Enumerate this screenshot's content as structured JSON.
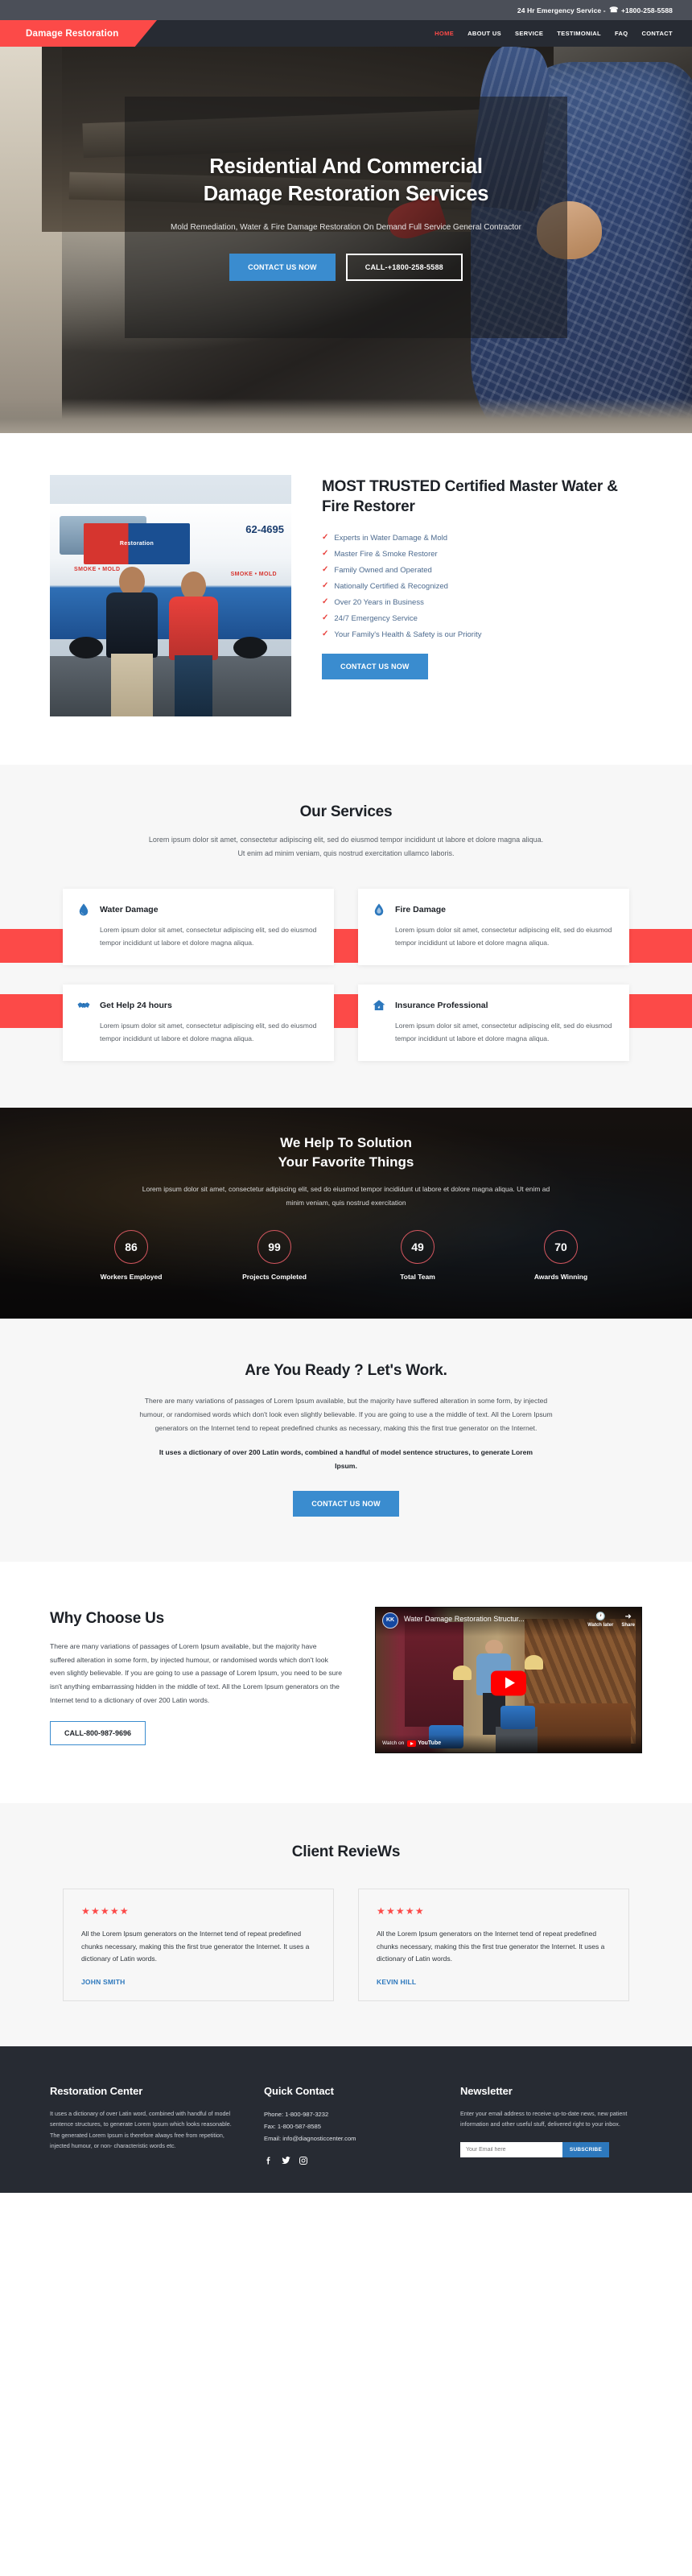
{
  "topbar": {
    "emergency_text": "24 Hr Emergency Service -",
    "phone": "+1800-258-5588",
    "phone_icon": "phone-icon"
  },
  "nav": {
    "logo": "Damage Restoration",
    "items": [
      {
        "label": "HOME",
        "active": true
      },
      {
        "label": "ABOUT US",
        "active": false
      },
      {
        "label": "SERVICE",
        "active": false
      },
      {
        "label": "TESTIMONIAL",
        "active": false
      },
      {
        "label": "FAQ",
        "active": false
      },
      {
        "label": "CONTACT",
        "active": false
      }
    ]
  },
  "hero": {
    "title_line1": "Residential And Commercial",
    "title_line2": "Damage Restoration Services",
    "subtitle": "Mold Remediation, Water & Fire Damage Restoration On Demand Full Service General Contractor",
    "primary_button": "CONTACT US NOW",
    "secondary_button": "CALL-+1800-258-5588"
  },
  "trusted": {
    "photo_alt": "restoration-team-van-photo",
    "van_logo_text": "Restoration",
    "van_phone": "62-4695",
    "van_red_text": "SMOKE • MOLD",
    "van_red_text2": "SMOKE • MOLD",
    "title": "MOST TRUSTED Certified Master Water & Fire Restorer",
    "bullets": [
      "Experts in Water Damage & Mold",
      "Master Fire & Smoke Restorer",
      "Family Owned and Operated",
      "Nationally Certified & Recognized",
      "Over 20 Years in Business",
      "24/7 Emergency Service",
      "Your Family's Health & Safety is our Priority"
    ],
    "button": "CONTACT US NOW"
  },
  "services": {
    "title": "Our Services",
    "subtitle": "Lorem ipsum dolor sit amet, consectetur adipiscing elit, sed do eiusmod tempor incididunt ut labore et dolore magna aliqua. Ut enim ad minim veniam, quis nostrud exercitation ullamco laboris.",
    "cards": [
      {
        "icon": "water-drop-icon",
        "title": "Water Damage",
        "body": "Lorem ipsum dolor sit amet, consectetur adipiscing elit, sed do eiusmod tempor incididunt ut labore et dolore magna aliqua."
      },
      {
        "icon": "fire-drop-icon",
        "title": "Fire Damage",
        "body": "Lorem ipsum dolor sit amet, consectetur adipiscing elit, sed do eiusmod tempor incididunt ut labore et dolore magna aliqua."
      },
      {
        "icon": "handshake-icon",
        "title": "Get Help 24 hours",
        "body": "Lorem ipsum dolor sit amet, consectetur adipiscing elit, sed do eiusmod tempor incididunt ut labore et dolore magna aliqua."
      },
      {
        "icon": "house-shield-icon",
        "title": "Insurance Professional",
        "body": "Lorem ipsum dolor sit amet, consectetur adipiscing elit, sed do eiusmod tempor incididunt ut labore et dolore magna aliqua."
      }
    ]
  },
  "stats": {
    "title_line1": "We Help To Solution",
    "title_line2": "Your Favorite Things",
    "subtitle": "Lorem ipsum dolor sit amet, consectetur adipiscing elit, sed do eiusmod tempor incididunt ut labore et dolore magna aliqua. Ut enim ad minim veniam, quis nostrud exercitation",
    "items": [
      {
        "value": "86",
        "label": "Workers Employed"
      },
      {
        "value": "99",
        "label": "Projects Completed"
      },
      {
        "value": "49",
        "label": "Total Team"
      },
      {
        "value": "70",
        "label": "Awards Winning"
      }
    ]
  },
  "ready": {
    "title": "Are You Ready ? Let's Work.",
    "paragraph": "There are many variations of passages of Lorem Ipsum available, but the majority have suffered alteration in some form, by injected humour, or randomised words which don't look even slightly believable. If you are going to use a the middle of text. All the Lorem Ipsum generators on the Internet tend to repeat predefined chunks as necessary, making this the first true generator on the Internet.",
    "paragraph_bold": "It uses a dictionary of over 200 Latin words, combined a handful of model sentence structures, to generate Lorem Ipsum.",
    "button": "CONTACT US NOW"
  },
  "why": {
    "title": "Why Choose Us",
    "paragraph": "There are many variations of passages of Lorem Ipsum available, but the majority have suffered alteration in some form, by injected humour, or randomised words which don't look even slightly believable. If you are going to use a passage of Lorem Ipsum, you need to be sure isn't anything embarrassing hidden in the middle of text. All the Lorem Ipsum generators on the Internet tend to a dictionary of over 200 Latin words.",
    "button": "CALL-800-987-9696",
    "video": {
      "channel_badge": "KK",
      "title": "Water Damage Restoration Structur...",
      "watch_later": "Watch later",
      "watch_later_icon": "clock-icon",
      "share": "Share",
      "share_icon": "share-arrow-icon",
      "play_icon": "play-button-icon",
      "watch_on": "Watch on",
      "platform": "YouTube"
    }
  },
  "reviews": {
    "title": "Client RevieWs",
    "items": [
      {
        "stars": "★★★★★",
        "text": "All the Lorem Ipsum generators on the Internet tend of repeat predefined chunks necessary, making this the first true generator the Internet. It uses a dictionary of Latin words.",
        "name": "JOHN SMITH"
      },
      {
        "stars": "★★★★★",
        "text": "All the Lorem Ipsum generators on the Internet tend of repeat predefined chunks necessary, making this the first true generator the Internet. It uses a dictionary of Latin words.",
        "name": "KEVIN HILL"
      }
    ]
  },
  "footer": {
    "about": {
      "title": "Restoration Center",
      "text": "It uses a dictionary of over Latin word, combined with handful of model sentence structures, to generate Lorem Ipsum which looks reasonable. The generated Lorem Ipsum is therefore always free from repetition, injected humour, or non- characteristic words etc."
    },
    "contact": {
      "title": "Quick Contact",
      "phone": "Phone: 1-800-987-3232",
      "fax": "Fax: 1-800-587-8585",
      "email": "Email: info@diagnosticcenter.com",
      "social": [
        {
          "icon": "facebook-icon",
          "glyph": "f"
        },
        {
          "icon": "twitter-icon",
          "glyph": "🐦"
        },
        {
          "icon": "instagram-icon",
          "glyph": "◎"
        }
      ]
    },
    "newsletter": {
      "title": "Newsletter",
      "text": "Enter your email address to receive up-to-date news, new patient information and other useful stuff, delivered right to your inbox.",
      "placeholder": "Your Email here",
      "button": "SUBSCRIBE"
    }
  },
  "colors": {
    "brand_red": "#fc4a48",
    "accent_blue": "#3a8ccf",
    "dark": "#272b33",
    "topbar": "#4b4f58"
  }
}
